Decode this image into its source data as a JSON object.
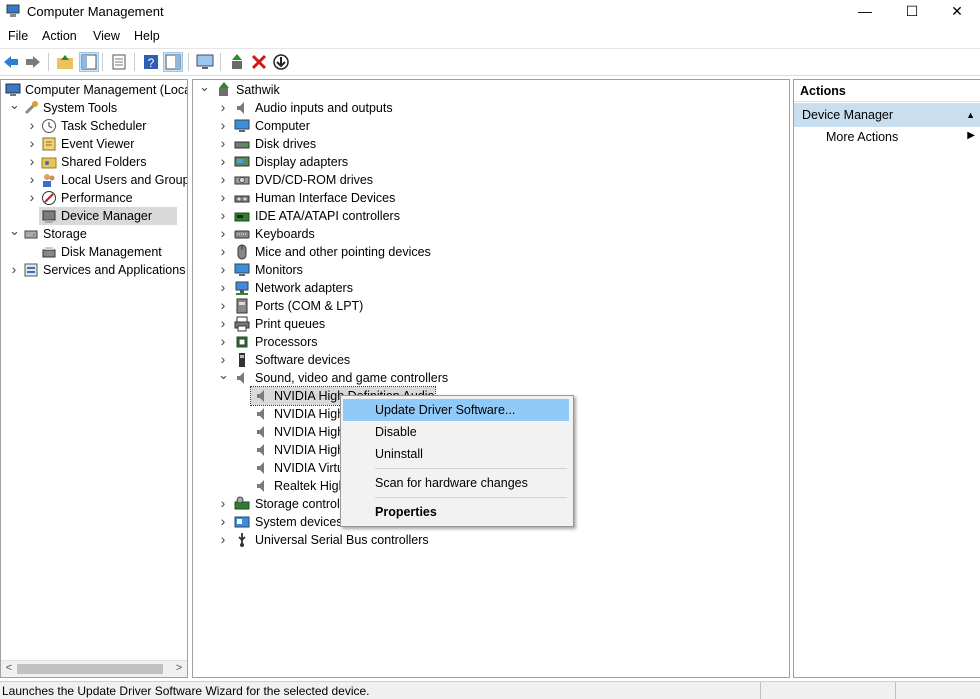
{
  "window": {
    "title": "Computer Management",
    "min": "—",
    "max": "☐",
    "close": "✕"
  },
  "menu": [
    "File",
    "Action",
    "View",
    "Help"
  ],
  "left_tree": [
    {
      "label": "Computer Management (Local",
      "icon": "computer-management-icon",
      "expander": "",
      "level": 0
    },
    {
      "label": "System Tools",
      "icon": "system-tools-icon",
      "expander": "open",
      "level": 1
    },
    {
      "label": "Task Scheduler",
      "icon": "clock-icon",
      "expander": "closed",
      "level": 2
    },
    {
      "label": "Event Viewer",
      "icon": "event-viewer-icon",
      "expander": "closed",
      "level": 2
    },
    {
      "label": "Shared Folders",
      "icon": "shared-folder-icon",
      "expander": "closed",
      "level": 2
    },
    {
      "label": "Local Users and Groups",
      "icon": "users-icon",
      "expander": "closed",
      "level": 2
    },
    {
      "label": "Performance",
      "icon": "performance-icon",
      "expander": "closed",
      "level": 2
    },
    {
      "label": "Device Manager",
      "icon": "device-manager-icon",
      "expander": "",
      "level": 2,
      "selected": true
    },
    {
      "label": "Storage",
      "icon": "storage-icon",
      "expander": "open",
      "level": 1
    },
    {
      "label": "Disk Management",
      "icon": "disk-icon",
      "expander": "",
      "level": 2
    },
    {
      "label": "Services and Applications",
      "icon": "services-icon",
      "expander": "closed",
      "level": 1
    }
  ],
  "device_tree": {
    "root": "Sathwik",
    "categories": [
      {
        "label": "Audio inputs and outputs",
        "icon": "speaker-icon"
      },
      {
        "label": "Computer",
        "icon": "monitor-icon"
      },
      {
        "label": "Disk drives",
        "icon": "disk-drive-icon"
      },
      {
        "label": "Display adapters",
        "icon": "display-adapter-icon"
      },
      {
        "label": "DVD/CD-ROM drives",
        "icon": "dvd-icon"
      },
      {
        "label": "Human Interface Devices",
        "icon": "hid-icon"
      },
      {
        "label": "IDE ATA/ATAPI controllers",
        "icon": "ide-icon"
      },
      {
        "label": "Keyboards",
        "icon": "keyboard-icon"
      },
      {
        "label": "Mice and other pointing devices",
        "icon": "mouse-icon"
      },
      {
        "label": "Monitors",
        "icon": "monitor-icon"
      },
      {
        "label": "Network adapters",
        "icon": "network-icon"
      },
      {
        "label": "Ports (COM & LPT)",
        "icon": "port-icon"
      },
      {
        "label": "Print queues",
        "icon": "printer-icon"
      },
      {
        "label": "Processors",
        "icon": "processor-icon"
      },
      {
        "label": "Software devices",
        "icon": "software-device-icon"
      },
      {
        "label": "Sound, video and game controllers",
        "icon": "speaker-icon",
        "expanded": true
      }
    ],
    "sound_children": [
      "NVIDIA High Definition Audio",
      "NVIDIA High",
      "NVIDIA High",
      "NVIDIA High",
      "NVIDIA Virtu",
      "Realtek High"
    ],
    "after_categories": [
      {
        "label": "Storage controll",
        "icon": "storage-controller-icon"
      },
      {
        "label": "System devices",
        "icon": "system-devices-icon"
      },
      {
        "label": "Universal Serial Bus controllers",
        "icon": "usb-icon"
      }
    ]
  },
  "context_menu": {
    "items": [
      "Update Driver Software...",
      "Disable",
      "Uninstall",
      "Scan for hardware changes",
      "Properties"
    ],
    "highlighted": "Update Driver Software..."
  },
  "actions": {
    "header": "Actions",
    "group": "Device Manager",
    "item": "More Actions"
  },
  "status": {
    "text": "Launches the Update Driver Software Wizard for the selected device."
  },
  "colors": {
    "selection": "#d9d9d9",
    "highlight": "#91c9f7",
    "actions_group": "#c9deef"
  }
}
